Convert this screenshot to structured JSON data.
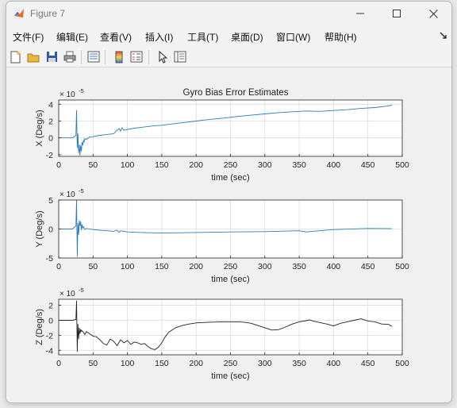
{
  "window": {
    "title": "Figure 7"
  },
  "menu": [
    "文件(F)",
    "编辑(E)",
    "查看(V)",
    "插入(I)",
    "工具(T)",
    "桌面(D)",
    "窗口(W)",
    "帮助(H)"
  ],
  "figure": {
    "main_title": "Gyro Bias Error Estimates"
  },
  "chart_data": [
    {
      "type": "line",
      "title": "Gyro Bias Error Estimates",
      "xlabel": "time (sec)",
      "ylabel": "X (Deg/s)",
      "exponent_label": "× 10",
      "exponent": "-5",
      "xlim": [
        0,
        500
      ],
      "ylim": [
        -2.2,
        4.5
      ],
      "xticks": [
        0,
        50,
        100,
        150,
        200,
        250,
        300,
        350,
        400,
        450,
        500
      ],
      "yticks": [
        -2,
        0,
        2,
        4
      ],
      "grid": true,
      "color": "#2e7cb8",
      "x": [
        0,
        20,
        25,
        26,
        27,
        28,
        29,
        30,
        31,
        32,
        33,
        34,
        35,
        36,
        37,
        38,
        40,
        45,
        50,
        60,
        70,
        80,
        85,
        88,
        90,
        92,
        95,
        100,
        110,
        120,
        130,
        140,
        150,
        160,
        170,
        180,
        190,
        200,
        220,
        240,
        260,
        280,
        300,
        320,
        340,
        350,
        360,
        380,
        400,
        420,
        440,
        460,
        480,
        485
      ],
      "y": [
        0,
        0,
        0.3,
        3.3,
        -1.2,
        0.5,
        -1.8,
        -0.8,
        -2.1,
        -0.9,
        -1.6,
        -0.5,
        -0.9,
        -0.3,
        -0.5,
        -0.1,
        -0.2,
        0.1,
        0.15,
        0.3,
        0.4,
        0.5,
        0.9,
        1.1,
        0.8,
        1.2,
        0.9,
        1.0,
        1.15,
        1.25,
        1.35,
        1.45,
        1.5,
        1.6,
        1.7,
        1.8,
        1.9,
        2.0,
        2.2,
        2.35,
        2.55,
        2.7,
        2.85,
        3.0,
        3.1,
        3.15,
        3.2,
        3.15,
        3.25,
        3.35,
        3.5,
        3.6,
        3.8,
        3.9
      ]
    },
    {
      "type": "line",
      "xlabel": "time (sec)",
      "ylabel": "Y (Deg/s)",
      "exponent_label": "× 10",
      "exponent": "-5",
      "xlim": [
        0,
        500
      ],
      "ylim": [
        -5,
        5
      ],
      "xticks": [
        0,
        50,
        100,
        150,
        200,
        250,
        300,
        350,
        400,
        450,
        500
      ],
      "yticks": [
        -5,
        0,
        5
      ],
      "grid": true,
      "color": "#2e7cb8",
      "x": [
        0,
        20,
        25,
        26,
        27,
        28,
        29,
        30,
        31,
        32,
        33,
        34,
        35,
        36,
        38,
        40,
        50,
        60,
        70,
        80,
        85,
        88,
        90,
        100,
        120,
        150,
        200,
        250,
        300,
        350,
        360,
        400,
        450,
        485
      ],
      "y": [
        0,
        0,
        0.5,
        5.0,
        -4.8,
        1.0,
        -1.0,
        1.5,
        0.5,
        1.3,
        -0.2,
        0.8,
        0.2,
        0.4,
        -0.1,
        0.1,
        -0.1,
        -0.2,
        -0.3,
        -0.4,
        -0.2,
        -0.6,
        -0.3,
        -0.5,
        -0.6,
        -0.7,
        -0.6,
        -0.5,
        -0.45,
        -0.3,
        -0.5,
        -0.1,
        0.1,
        0.05
      ]
    },
    {
      "type": "line",
      "xlabel": "time (sec)",
      "ylabel": "Z (Deg/s)",
      "exponent_label": "× 10",
      "exponent": "-5",
      "xlim": [
        0,
        500
      ],
      "ylim": [
        -4.6,
        2.8
      ],
      "xticks": [
        0,
        50,
        100,
        150,
        200,
        250,
        300,
        350,
        400,
        450,
        500
      ],
      "yticks": [
        -4,
        -2,
        0,
        2
      ],
      "grid": true,
      "color": "#222222",
      "x": [
        0,
        20,
        25,
        26,
        27,
        28,
        29,
        30,
        31,
        32,
        33,
        34,
        36,
        38,
        40,
        45,
        50,
        55,
        60,
        65,
        70,
        75,
        80,
        85,
        90,
        95,
        100,
        105,
        110,
        115,
        120,
        125,
        130,
        135,
        140,
        145,
        150,
        155,
        160,
        170,
        180,
        190,
        200,
        210,
        220,
        240,
        260,
        270,
        280,
        290,
        300,
        310,
        320,
        330,
        340,
        350,
        360,
        365,
        370,
        380,
        385,
        390,
        400,
        410,
        420,
        430,
        440,
        450,
        460,
        470,
        480,
        485
      ],
      "y": [
        0,
        0,
        0.1,
        2.6,
        -4.2,
        -0.5,
        -2.5,
        -1.0,
        -1.8,
        -1.2,
        -1.5,
        -1.4,
        -1.6,
        -1.9,
        -1.5,
        -1.8,
        -2.1,
        -2.2,
        -2.6,
        -3.1,
        -3.3,
        -2.5,
        -2.8,
        -3.4,
        -2.6,
        -3.0,
        -2.7,
        -3.2,
        -2.9,
        -3.0,
        -3.2,
        -3.1,
        -3.5,
        -3.8,
        -3.9,
        -3.6,
        -3.0,
        -2.2,
        -1.6,
        -1.0,
        -0.7,
        -0.5,
        -0.35,
        -0.3,
        -0.25,
        -0.2,
        -0.2,
        -0.25,
        -0.4,
        -0.7,
        -1.0,
        -1.3,
        -1.25,
        -0.9,
        -0.5,
        -0.2,
        -0.05,
        0.05,
        -0.1,
        -0.3,
        -0.4,
        -0.5,
        -0.75,
        -0.4,
        -0.2,
        0.0,
        0.2,
        -0.1,
        -0.2,
        -0.5,
        -0.55,
        -0.8
      ]
    }
  ]
}
